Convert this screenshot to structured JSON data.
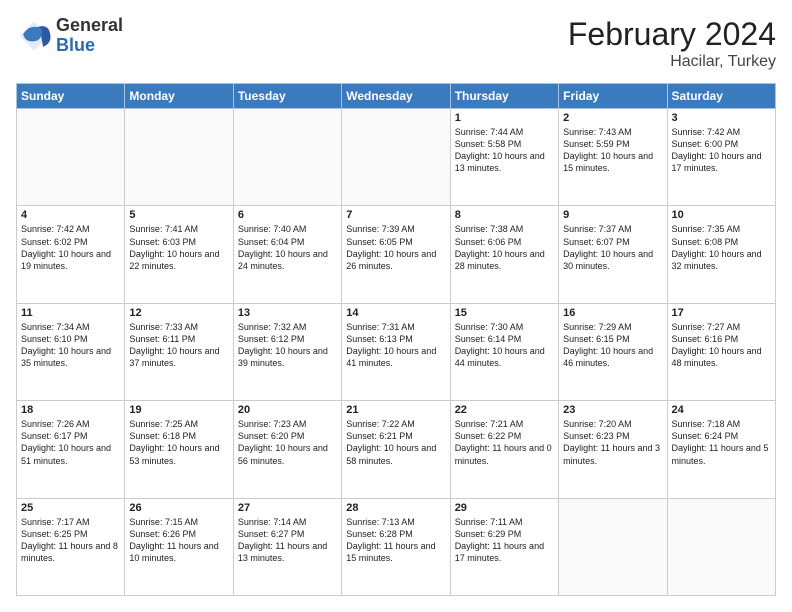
{
  "header": {
    "logo_general": "General",
    "logo_blue": "Blue",
    "month_title": "February 2024",
    "location": "Hacilar, Turkey"
  },
  "weekdays": [
    "Sunday",
    "Monday",
    "Tuesday",
    "Wednesday",
    "Thursday",
    "Friday",
    "Saturday"
  ],
  "rows": [
    [
      {
        "day": "",
        "info": ""
      },
      {
        "day": "",
        "info": ""
      },
      {
        "day": "",
        "info": ""
      },
      {
        "day": "",
        "info": ""
      },
      {
        "day": "1",
        "info": "Sunrise: 7:44 AM\nSunset: 5:58 PM\nDaylight: 10 hours\nand 13 minutes."
      },
      {
        "day": "2",
        "info": "Sunrise: 7:43 AM\nSunset: 5:59 PM\nDaylight: 10 hours\nand 15 minutes."
      },
      {
        "day": "3",
        "info": "Sunrise: 7:42 AM\nSunset: 6:00 PM\nDaylight: 10 hours\nand 17 minutes."
      }
    ],
    [
      {
        "day": "4",
        "info": "Sunrise: 7:42 AM\nSunset: 6:02 PM\nDaylight: 10 hours\nand 19 minutes."
      },
      {
        "day": "5",
        "info": "Sunrise: 7:41 AM\nSunset: 6:03 PM\nDaylight: 10 hours\nand 22 minutes."
      },
      {
        "day": "6",
        "info": "Sunrise: 7:40 AM\nSunset: 6:04 PM\nDaylight: 10 hours\nand 24 minutes."
      },
      {
        "day": "7",
        "info": "Sunrise: 7:39 AM\nSunset: 6:05 PM\nDaylight: 10 hours\nand 26 minutes."
      },
      {
        "day": "8",
        "info": "Sunrise: 7:38 AM\nSunset: 6:06 PM\nDaylight: 10 hours\nand 28 minutes."
      },
      {
        "day": "9",
        "info": "Sunrise: 7:37 AM\nSunset: 6:07 PM\nDaylight: 10 hours\nand 30 minutes."
      },
      {
        "day": "10",
        "info": "Sunrise: 7:35 AM\nSunset: 6:08 PM\nDaylight: 10 hours\nand 32 minutes."
      }
    ],
    [
      {
        "day": "11",
        "info": "Sunrise: 7:34 AM\nSunset: 6:10 PM\nDaylight: 10 hours\nand 35 minutes."
      },
      {
        "day": "12",
        "info": "Sunrise: 7:33 AM\nSunset: 6:11 PM\nDaylight: 10 hours\nand 37 minutes."
      },
      {
        "day": "13",
        "info": "Sunrise: 7:32 AM\nSunset: 6:12 PM\nDaylight: 10 hours\nand 39 minutes."
      },
      {
        "day": "14",
        "info": "Sunrise: 7:31 AM\nSunset: 6:13 PM\nDaylight: 10 hours\nand 41 minutes."
      },
      {
        "day": "15",
        "info": "Sunrise: 7:30 AM\nSunset: 6:14 PM\nDaylight: 10 hours\nand 44 minutes."
      },
      {
        "day": "16",
        "info": "Sunrise: 7:29 AM\nSunset: 6:15 PM\nDaylight: 10 hours\nand 46 minutes."
      },
      {
        "day": "17",
        "info": "Sunrise: 7:27 AM\nSunset: 6:16 PM\nDaylight: 10 hours\nand 48 minutes."
      }
    ],
    [
      {
        "day": "18",
        "info": "Sunrise: 7:26 AM\nSunset: 6:17 PM\nDaylight: 10 hours\nand 51 minutes."
      },
      {
        "day": "19",
        "info": "Sunrise: 7:25 AM\nSunset: 6:18 PM\nDaylight: 10 hours\nand 53 minutes."
      },
      {
        "day": "20",
        "info": "Sunrise: 7:23 AM\nSunset: 6:20 PM\nDaylight: 10 hours\nand 56 minutes."
      },
      {
        "day": "21",
        "info": "Sunrise: 7:22 AM\nSunset: 6:21 PM\nDaylight: 10 hours\nand 58 minutes."
      },
      {
        "day": "22",
        "info": "Sunrise: 7:21 AM\nSunset: 6:22 PM\nDaylight: 11 hours\nand 0 minutes."
      },
      {
        "day": "23",
        "info": "Sunrise: 7:20 AM\nSunset: 6:23 PM\nDaylight: 11 hours\nand 3 minutes."
      },
      {
        "day": "24",
        "info": "Sunrise: 7:18 AM\nSunset: 6:24 PM\nDaylight: 11 hours\nand 5 minutes."
      }
    ],
    [
      {
        "day": "25",
        "info": "Sunrise: 7:17 AM\nSunset: 6:25 PM\nDaylight: 11 hours\nand 8 minutes."
      },
      {
        "day": "26",
        "info": "Sunrise: 7:15 AM\nSunset: 6:26 PM\nDaylight: 11 hours\nand 10 minutes."
      },
      {
        "day": "27",
        "info": "Sunrise: 7:14 AM\nSunset: 6:27 PM\nDaylight: 11 hours\nand 13 minutes."
      },
      {
        "day": "28",
        "info": "Sunrise: 7:13 AM\nSunset: 6:28 PM\nDaylight: 11 hours\nand 15 minutes."
      },
      {
        "day": "29",
        "info": "Sunrise: 7:11 AM\nSunset: 6:29 PM\nDaylight: 11 hours\nand 17 minutes."
      },
      {
        "day": "",
        "info": ""
      },
      {
        "day": "",
        "info": ""
      }
    ]
  ]
}
